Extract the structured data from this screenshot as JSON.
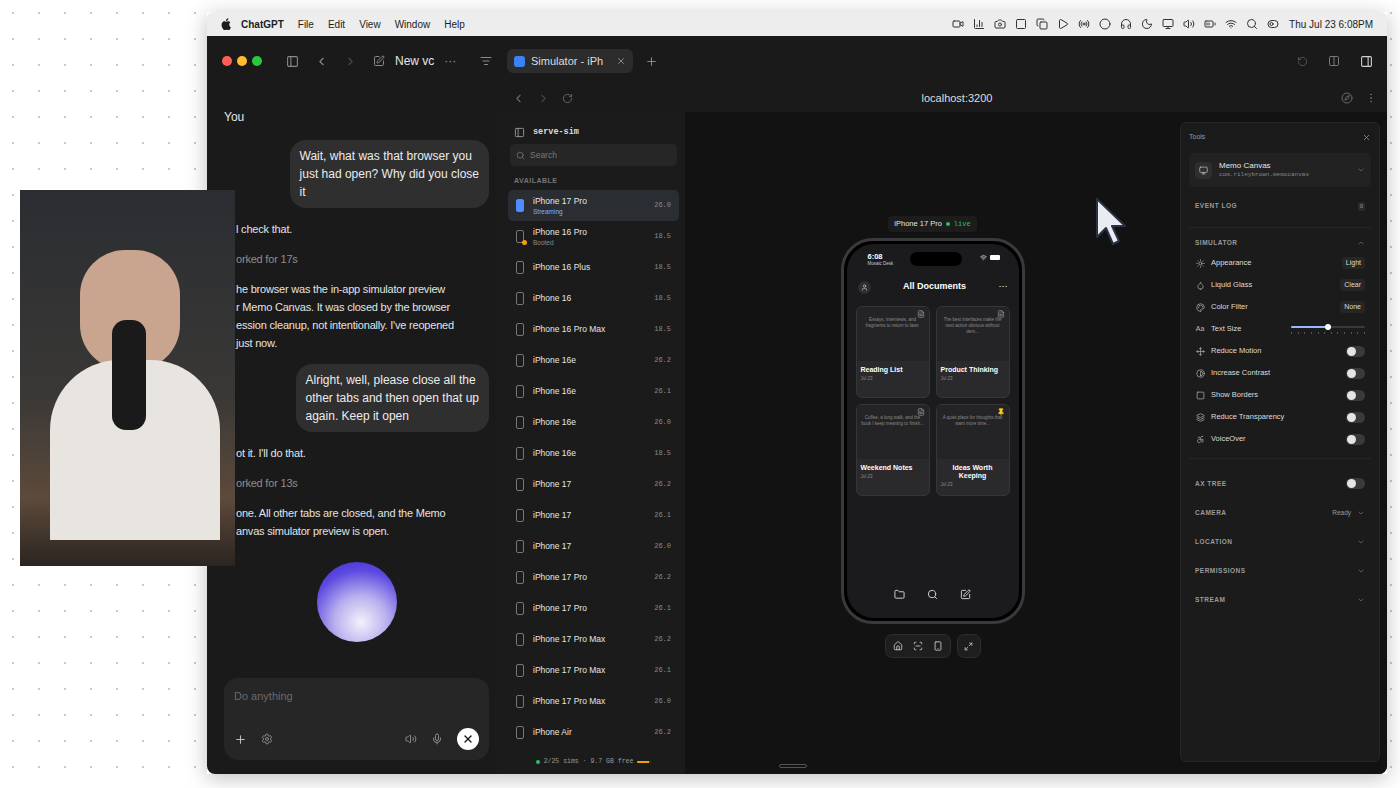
{
  "menu_bar": {
    "app": "ChatGPT",
    "items": [
      "File",
      "Edit",
      "View",
      "Window",
      "Help"
    ],
    "clock": "Thu Jul 23 6:08PM"
  },
  "window": {
    "title": "New vc",
    "more": "···",
    "tabs": [
      {
        "label": "Simulator - iPh",
        "selected": true
      }
    ]
  },
  "chat": {
    "author": "You",
    "messages": [
      {
        "kind": "user",
        "lines": [
          "Wait, what was that browser you",
          "just had open? Why did you close",
          "it"
        ]
      },
      {
        "kind": "assistant",
        "lines": [
          "l check that."
        ]
      },
      {
        "kind": "status",
        "lines": [
          "orked for 17s"
        ]
      },
      {
        "kind": "assistant",
        "lines": [
          "he browser was the in-app simulator preview",
          "r Memo Canvas. It was closed by the browser",
          "ession cleanup, not intentionally. I've reopened",
          "just now."
        ]
      },
      {
        "kind": "user",
        "lines": [
          "Alright, well, please close all the",
          "other tabs and then open that up",
          "again. Keep it open"
        ]
      },
      {
        "kind": "assistant",
        "lines": [
          "ot it. I'll do that."
        ]
      },
      {
        "kind": "status",
        "lines": [
          "orked for 13s"
        ]
      },
      {
        "kind": "assistant",
        "lines": [
          "one. All other tabs are closed, and the Memo",
          "anvas simulator preview is open."
        ]
      }
    ],
    "input_placeholder": "Do anything"
  },
  "browser": {
    "url": "localhost:3200"
  },
  "sidebar": {
    "title": "serve-sim",
    "search_placeholder": "Search",
    "section": "AVAILABLE",
    "devices": [
      {
        "name": "iPhone 17 Pro",
        "version": "26.0",
        "status": "Streaming",
        "booted": false,
        "selected": true
      },
      {
        "name": "iPhone 16 Pro",
        "version": "18.5",
        "status": "Booted",
        "booted": true,
        "selected": false
      },
      {
        "name": "iPhone 16 Plus",
        "version": "18.5",
        "status": "",
        "booted": false,
        "selected": false
      },
      {
        "name": "iPhone 16",
        "version": "18.5",
        "status": "",
        "booted": false,
        "selected": false
      },
      {
        "name": "iPhone 16 Pro Max",
        "version": "18.5",
        "status": "",
        "booted": false,
        "selected": false
      },
      {
        "name": "iPhone 16e",
        "version": "26.2",
        "status": "",
        "booted": false,
        "selected": false
      },
      {
        "name": "iPhone 16e",
        "version": "26.1",
        "status": "",
        "booted": false,
        "selected": false
      },
      {
        "name": "iPhone 16e",
        "version": "26.0",
        "status": "",
        "booted": false,
        "selected": false
      },
      {
        "name": "iPhone 16e",
        "version": "18.5",
        "status": "",
        "booted": false,
        "selected": false
      },
      {
        "name": "iPhone 17",
        "version": "26.2",
        "status": "",
        "booted": false,
        "selected": false
      },
      {
        "name": "iPhone 17",
        "version": "26.1",
        "status": "",
        "booted": false,
        "selected": false
      },
      {
        "name": "iPhone 17",
        "version": "26.0",
        "status": "",
        "booted": false,
        "selected": false
      },
      {
        "name": "iPhone 17 Pro",
        "version": "26.2",
        "status": "",
        "booted": false,
        "selected": false
      },
      {
        "name": "iPhone 17 Pro",
        "version": "26.1",
        "status": "",
        "booted": false,
        "selected": false
      },
      {
        "name": "iPhone 17 Pro Max",
        "version": "26.2",
        "status": "",
        "booted": false,
        "selected": false
      },
      {
        "name": "iPhone 17 Pro Max",
        "version": "26.1",
        "status": "",
        "booted": false,
        "selected": false
      },
      {
        "name": "iPhone 17 Pro Max",
        "version": "26.0",
        "status": "",
        "booted": false,
        "selected": false
      },
      {
        "name": "iPhone Air",
        "version": "26.2",
        "status": "",
        "booted": false,
        "selected": false
      }
    ],
    "footer": {
      "text": "2/25 sims · 9.7 GB free",
      "level": 0.85
    }
  },
  "phone": {
    "label": "iPhone 17 Pro",
    "live": "live",
    "time": "6:08",
    "back": "Mosaic Desk",
    "title": "All Documents",
    "more": "···",
    "documents": [
      {
        "title": "Reading List",
        "preview": "Essays, interviews, and fragments to return to later.",
        "date": "Jul 23",
        "pinned": false
      },
      {
        "title": "Product Thinking",
        "preview": "The best interfaces make the next action obvious without dem...",
        "date": "Jul 23",
        "pinned": false
      },
      {
        "title": "Weekend Notes",
        "preview": "Coffee, a long walk, and the book I keep meaning to finish...",
        "date": "Jul 23",
        "pinned": false
      },
      {
        "title": "Ideas Worth Keeping",
        "preview": "A quiet place for thoughts that want more time...",
        "date": "Jul 23",
        "pinned": true
      }
    ]
  },
  "tools": {
    "title": "Tools",
    "app": {
      "name": "Memo Canvas",
      "bundle": "com.rileybrown.memocanvas"
    },
    "event_log": {
      "label": "EVENT LOG",
      "count": "0"
    },
    "simulator": {
      "label": "SIMULATOR",
      "expanded": true,
      "rows": [
        {
          "kind": "select",
          "label": "Appearance",
          "value": "Light"
        },
        {
          "kind": "select",
          "label": "Liquid Glass",
          "value": "Clear"
        },
        {
          "kind": "select",
          "label": "Color Filter",
          "value": "None"
        },
        {
          "kind": "slider",
          "label": "Text Size",
          "glyph": "Aa",
          "level": 0.5
        },
        {
          "kind": "toggle",
          "label": "Reduce Motion",
          "on": false
        },
        {
          "kind": "toggle",
          "label": "Increase Contrast",
          "on": false
        },
        {
          "kind": "toggle",
          "label": "Show Borders",
          "on": false
        },
        {
          "kind": "toggle",
          "label": "Reduce Transparency",
          "on": false
        },
        {
          "kind": "toggle",
          "label": "VoiceOver",
          "on": false
        }
      ]
    },
    "sections": [
      {
        "kind": "toggle",
        "label": "AX TREE",
        "on": false
      },
      {
        "kind": "select",
        "label": "CAMERA",
        "value": "Ready"
      },
      {
        "kind": "collapsed",
        "label": "LOCATION"
      },
      {
        "kind": "collapsed",
        "label": "PERMISSIONS"
      },
      {
        "kind": "collapsed",
        "label": "STREAM"
      }
    ]
  }
}
